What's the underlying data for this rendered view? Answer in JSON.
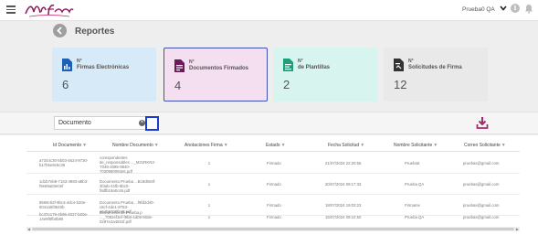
{
  "header": {
    "user_name": "Prueba0 QA"
  },
  "page": {
    "title": "Reportes"
  },
  "cards": [
    {
      "nro": "N°",
      "label": "Firmas Electrónicas",
      "value": "6"
    },
    {
      "nro": "N°",
      "label": "Documentos Firmados",
      "value": "4"
    },
    {
      "nro": "N°",
      "label": "de Plantillas",
      "value": "2"
    },
    {
      "nro": "N°",
      "label": "Solicitudes de Firma",
      "value": "12"
    }
  ],
  "filter": {
    "search_value": "Documento"
  },
  "table": {
    "columns": [
      "Id Documento",
      "Nombre Documento",
      "Anotaciones Firma",
      "Estado",
      "Fecha Solicitud",
      "Nombre Solicitante",
      "Correo Solicitante"
    ],
    "rows": [
      {
        "id": "a7344c30-5b03-4624-9730-b17b5e9c6c36",
        "name": "corespondentes de_responsables\n..._M31RKN2-T045-4085-9840-7030980093e6.pdf",
        "notes": "1",
        "status": "Firmado",
        "date": "21/07/2024 22:20:55",
        "requester": "Prueba0",
        "email": "pruebas@gmail.com"
      },
      {
        "id": "1d1b7eb8-7163-4983-a8b3-f9e69a03e0ef",
        "name": "Documento Prueba ...Bc8d0e8f-3f4ab-41fb-8bc0-f8dfb18a0c46.pdf",
        "notes": "1",
        "status": "Firmado",
        "date": "20/07/2024 09:17:33",
        "requester": "Prueba QA",
        "email": "pruebas@gmail.com"
      },
      {
        "id": "8569c62f-9bc3-4dc4-b20e-6041a6f3540b",
        "name": "Documento Prueba ...f9fd2d40-c8cf-4de1-9763-a64b8700f2e8.pdf",
        "notes": "1",
        "status": "Firmado",
        "date": "18/07/2024 19:03:23",
        "requester": "Firmame",
        "email": "pruebas@gmail.com"
      },
      {
        "id": "bc37e179-4b96-4027-b00e-14e9f5fb0b80",
        "name": "Documento de Prueba.p ..._7082ef3ef-f8b8-4d09-90de-0297e2a4831f.pdf",
        "notes": "1",
        "status": "Firmado",
        "date": "15/07/2024 09:10:50",
        "requester": "Prueba QA",
        "email": "pruebas@gmail.com"
      }
    ]
  }
}
